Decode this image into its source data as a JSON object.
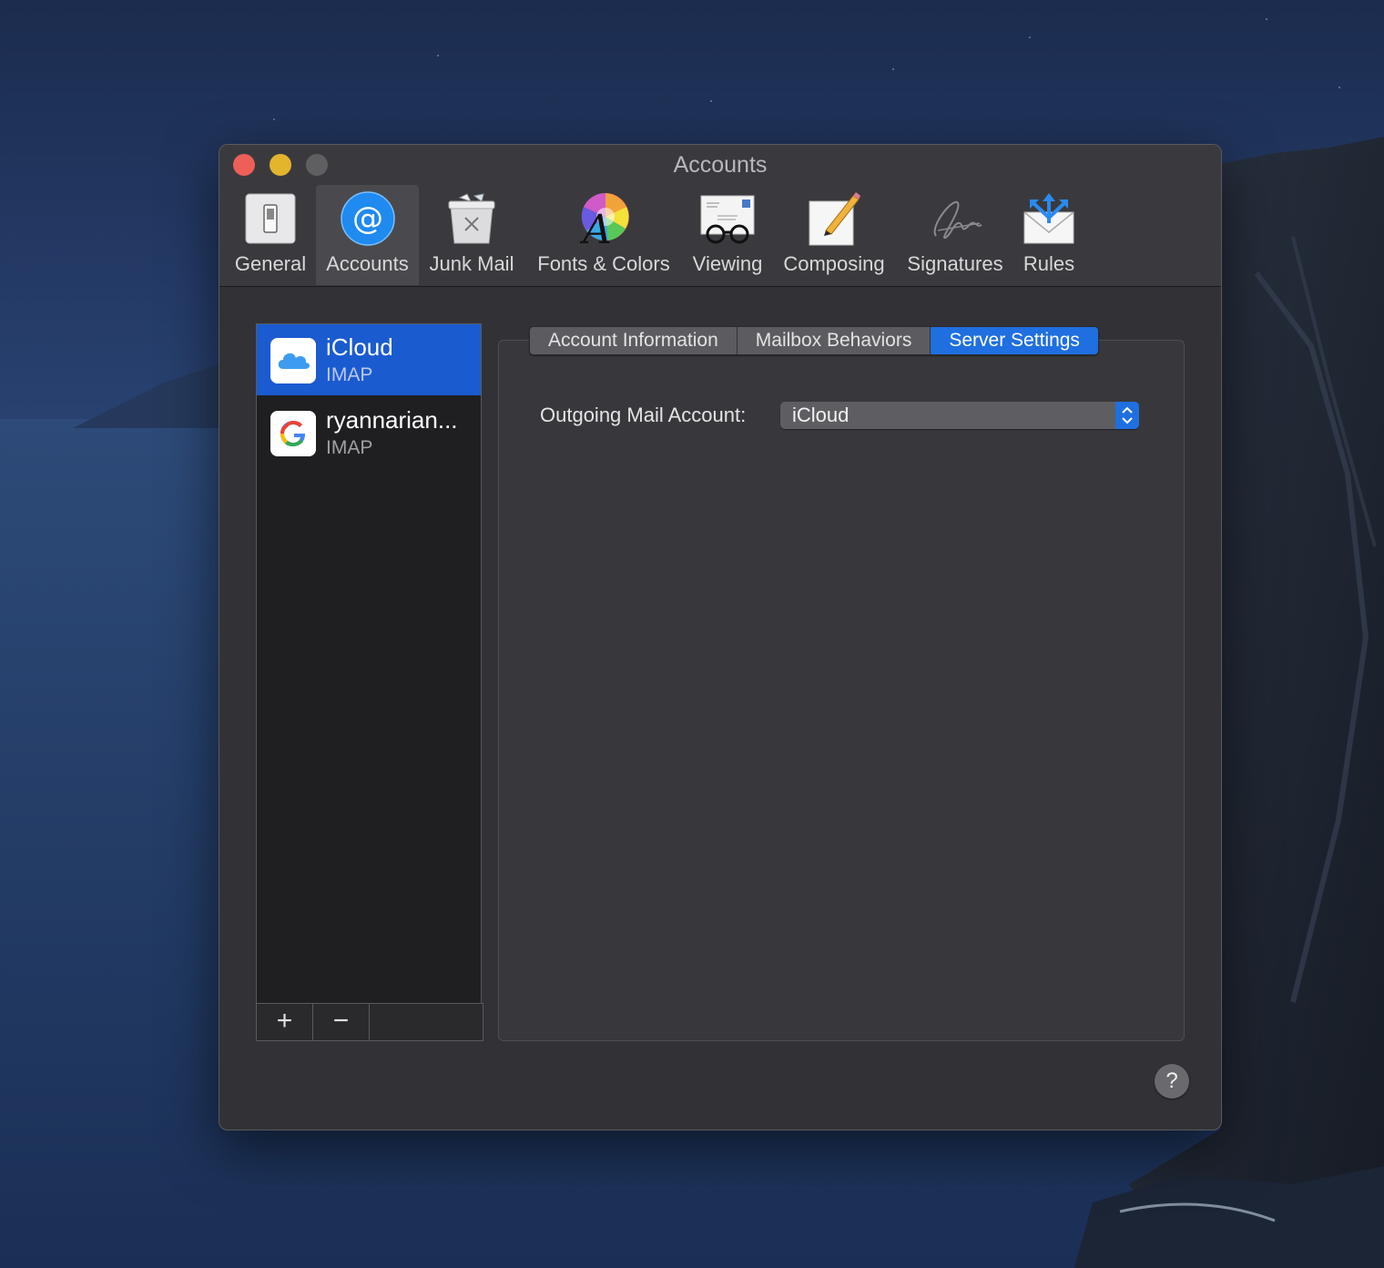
{
  "window": {
    "title": "Accounts"
  },
  "toolbar": {
    "items": [
      {
        "label": "General",
        "icon": "general-switch-icon"
      },
      {
        "label": "Accounts",
        "icon": "at-sign-icon",
        "selected": true
      },
      {
        "label": "Junk Mail",
        "icon": "trash-bin-icon"
      },
      {
        "label": "Fonts & Colors",
        "icon": "color-wheel-font-icon"
      },
      {
        "label": "Viewing",
        "icon": "envelope-glasses-icon"
      },
      {
        "label": "Composing",
        "icon": "paper-pencil-icon"
      },
      {
        "label": "Signatures",
        "icon": "signature-icon"
      },
      {
        "label": "Rules",
        "icon": "envelope-arrows-icon"
      }
    ]
  },
  "accounts": [
    {
      "name": "iCloud",
      "type": "IMAP",
      "icon": "icloud-icon",
      "selected": true
    },
    {
      "name": "ryannarian...",
      "type": "IMAP",
      "icon": "google-icon",
      "selected": false
    }
  ],
  "list_footer": {
    "add_label": "+",
    "remove_label": "−"
  },
  "tabs": [
    {
      "label": "Account Information",
      "active": false
    },
    {
      "label": "Mailbox Behaviors",
      "active": false
    },
    {
      "label": "Server Settings",
      "active": true
    }
  ],
  "server_settings": {
    "outgoing_label": "Outgoing Mail Account:",
    "outgoing_value": "iCloud"
  },
  "help": {
    "label": "?"
  },
  "colors": {
    "accent": "#1f6fe0",
    "selection": "#1b5bd0",
    "window_bg": "#323236"
  }
}
